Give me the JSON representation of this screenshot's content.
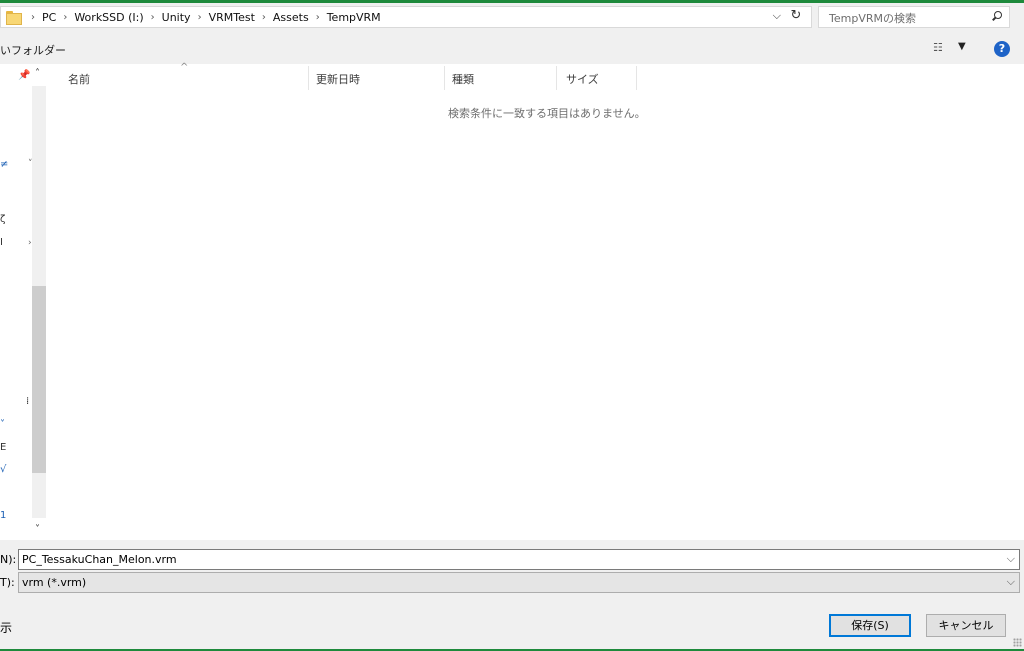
{
  "address": {
    "crumbs": [
      "PC",
      "WorkSSD (I:)",
      "Unity",
      "VRMTest",
      "Assets",
      "TempVRM"
    ],
    "separator": "›"
  },
  "search": {
    "placeholder": "TempVRMの検索"
  },
  "toolbar": {
    "new_folder_fragment": "いフォルダー",
    "help": "?"
  },
  "columns": [
    "名前",
    "更新日時",
    "種類",
    "サイズ"
  ],
  "empty_message": "検索条件に一致する項目はありません。",
  "nav_fragments": [
    "≠",
    "ζ",
    "I",
    "⁞",
    "˅",
    "E",
    "√",
    "1"
  ],
  "filename": {
    "label": "N):",
    "value": "PC_TessakuChan_Melon.vrm"
  },
  "filetype": {
    "label": "T):",
    "value": "vrm (*.vrm)"
  },
  "hide_folders_fragment": "示",
  "buttons": {
    "save": "保存(S)",
    "cancel": "キャンセル"
  },
  "colors": {
    "accent": "#0078d7",
    "window_border": "#1e8a3c",
    "help_icon": "#1e63c7"
  }
}
